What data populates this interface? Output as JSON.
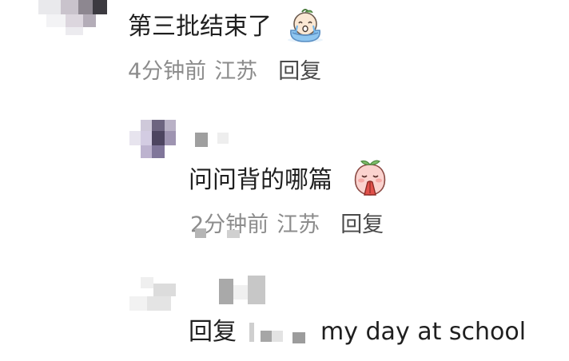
{
  "comments": [
    {
      "text": "第三批结束了",
      "emoji": "crying-doll-emoji",
      "time": "4分钟前",
      "location": "江苏",
      "reply_label": "回复"
    },
    {
      "text": "问问背的哪篇",
      "emoji": "praying-peach-emoji",
      "time": "2分钟前",
      "location": "江苏",
      "reply_label": "回复"
    },
    {
      "reply_prefix": "回复",
      "text": "my day at school"
    }
  ],
  "colors": {
    "text": "#1f1f1f",
    "meta": "#8c8c8c",
    "reply": "#4a4a4a"
  }
}
